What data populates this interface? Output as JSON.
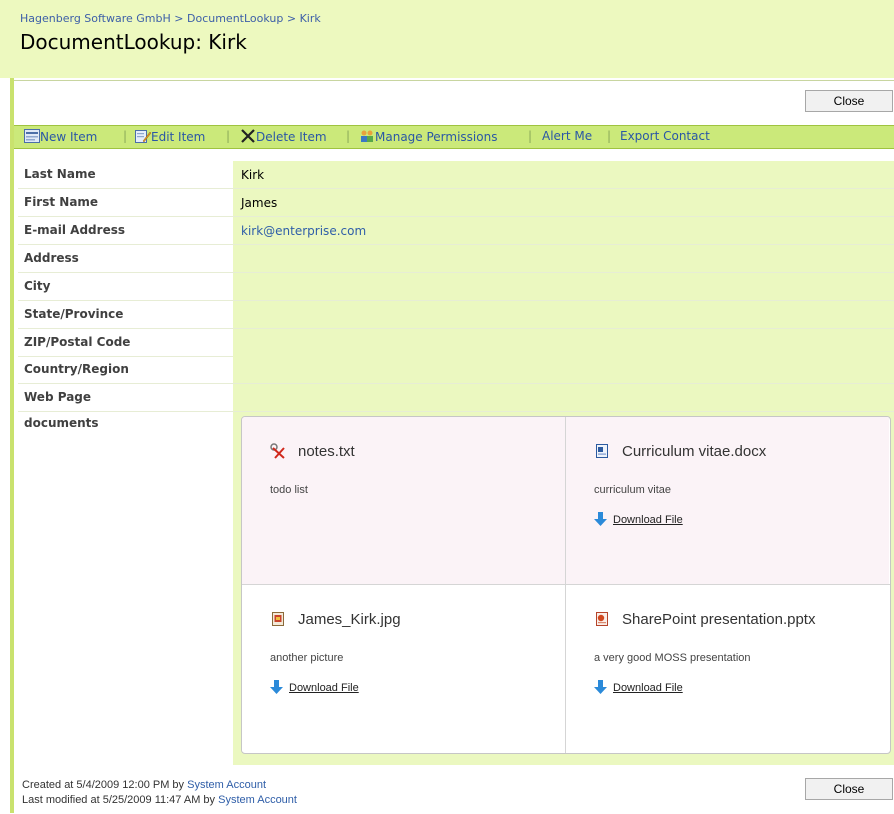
{
  "breadcrumb": {
    "site": "Hagenberg Software GmbH",
    "sep1": ">",
    "list": "DocumentLookup",
    "sep2": ">",
    "item": "Kirk"
  },
  "page_title": "DocumentLookup: Kirk",
  "buttons": {
    "close_label": "Close"
  },
  "toolbar": {
    "new_item": "New Item",
    "edit_item": "Edit Item",
    "delete_item": "Delete Item",
    "manage_permissions": "Manage Permissions",
    "alert_me": "Alert Me",
    "export_contact": "Export Contact",
    "separator": "|"
  },
  "fields": [
    {
      "label": "Last Name",
      "value": "Kirk"
    },
    {
      "label": "First Name",
      "value": "James"
    },
    {
      "label": "E-mail Address",
      "value": "kirk@enterprise.com"
    },
    {
      "label": "Address",
      "value": ""
    },
    {
      "label": "City",
      "value": ""
    },
    {
      "label": "State/Province",
      "value": ""
    },
    {
      "label": "ZIP/Postal Code",
      "value": ""
    },
    {
      "label": "Country/Region",
      "value": ""
    },
    {
      "label": "Web Page",
      "value": ""
    }
  ],
  "documents": {
    "label": "documents",
    "download_label": "Download File",
    "items": [
      {
        "name": "notes.txt",
        "description": "todo list",
        "icon": "txt-file-icon"
      },
      {
        "name": "Curriculum vitae.docx",
        "description": "curriculum vitae",
        "icon": "word-file-icon"
      },
      {
        "name": "James_Kirk.jpg",
        "description": "another picture",
        "icon": "image-file-icon"
      },
      {
        "name": "SharePoint presentation.pptx",
        "description": "a very good MOSS presentation",
        "icon": "powerpoint-file-icon"
      }
    ]
  },
  "footer": {
    "created_prefix": "Created at 5/4/2009 12:00 PM  by",
    "created_by": "System Account",
    "modified_prefix": "Last modified at 5/25/2009 11:47 AM  by",
    "modified_by": "System Account"
  },
  "colors": {
    "accent_green": "#cbe97a",
    "field_bg": "#ebf8c0",
    "link_blue": "#2f5ea8"
  }
}
